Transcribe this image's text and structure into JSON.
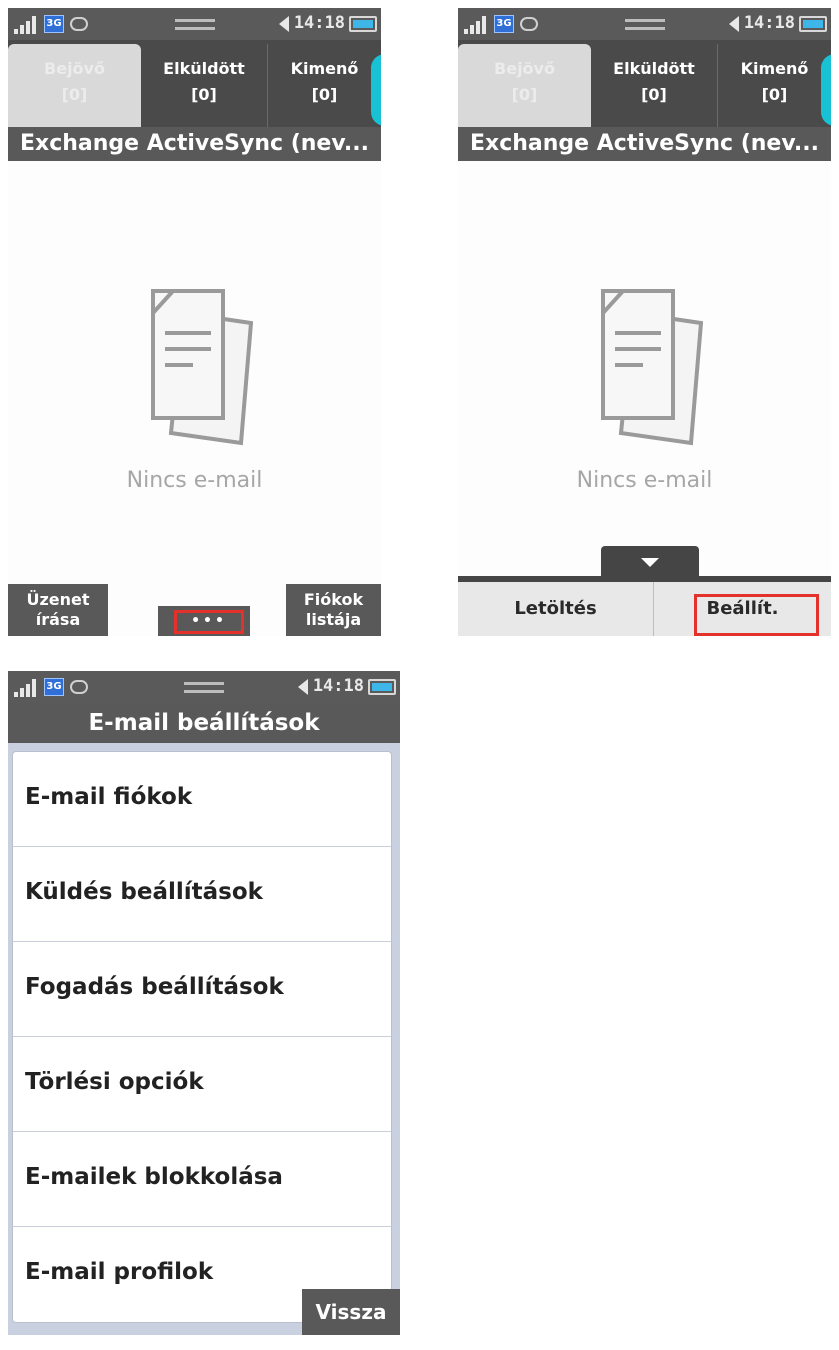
{
  "status_bar": {
    "network_label": "3G",
    "time": "14:18",
    "icons": [
      "signal-icon",
      "3g-icon",
      "sync-icon",
      "volume-icon",
      "battery-icon"
    ]
  },
  "inbox_screen": {
    "tabs": [
      {
        "label": "Bejövő",
        "count": "[0]",
        "active": true
      },
      {
        "label": "Elküldött",
        "count": "[0]",
        "active": false
      },
      {
        "label": "Kimenő",
        "count": "[0]",
        "active": false
      }
    ],
    "account_title": "Exchange ActiveSync (nev...",
    "empty_text": "Nincs e-mail",
    "compose_label": "Üzenet írása",
    "more_label": "•••",
    "accounts_label": "Fiókok listája"
  },
  "options_screen": {
    "download_label": "Letöltés",
    "settings_label": "Beállít."
  },
  "settings_screen": {
    "title": "E-mail beállítások",
    "items": [
      "E-mail fiókok",
      "Küldés beállítások",
      "Fogadás beállítások",
      "Törlési opciók",
      "E-mailek blokkolása",
      "E-mail profilok"
    ],
    "back_label": "Vissza"
  },
  "colors": {
    "bar": "#595959",
    "highlight": "#e3312b",
    "accent": "#18c2d4",
    "battery": "#3fb6e8"
  }
}
